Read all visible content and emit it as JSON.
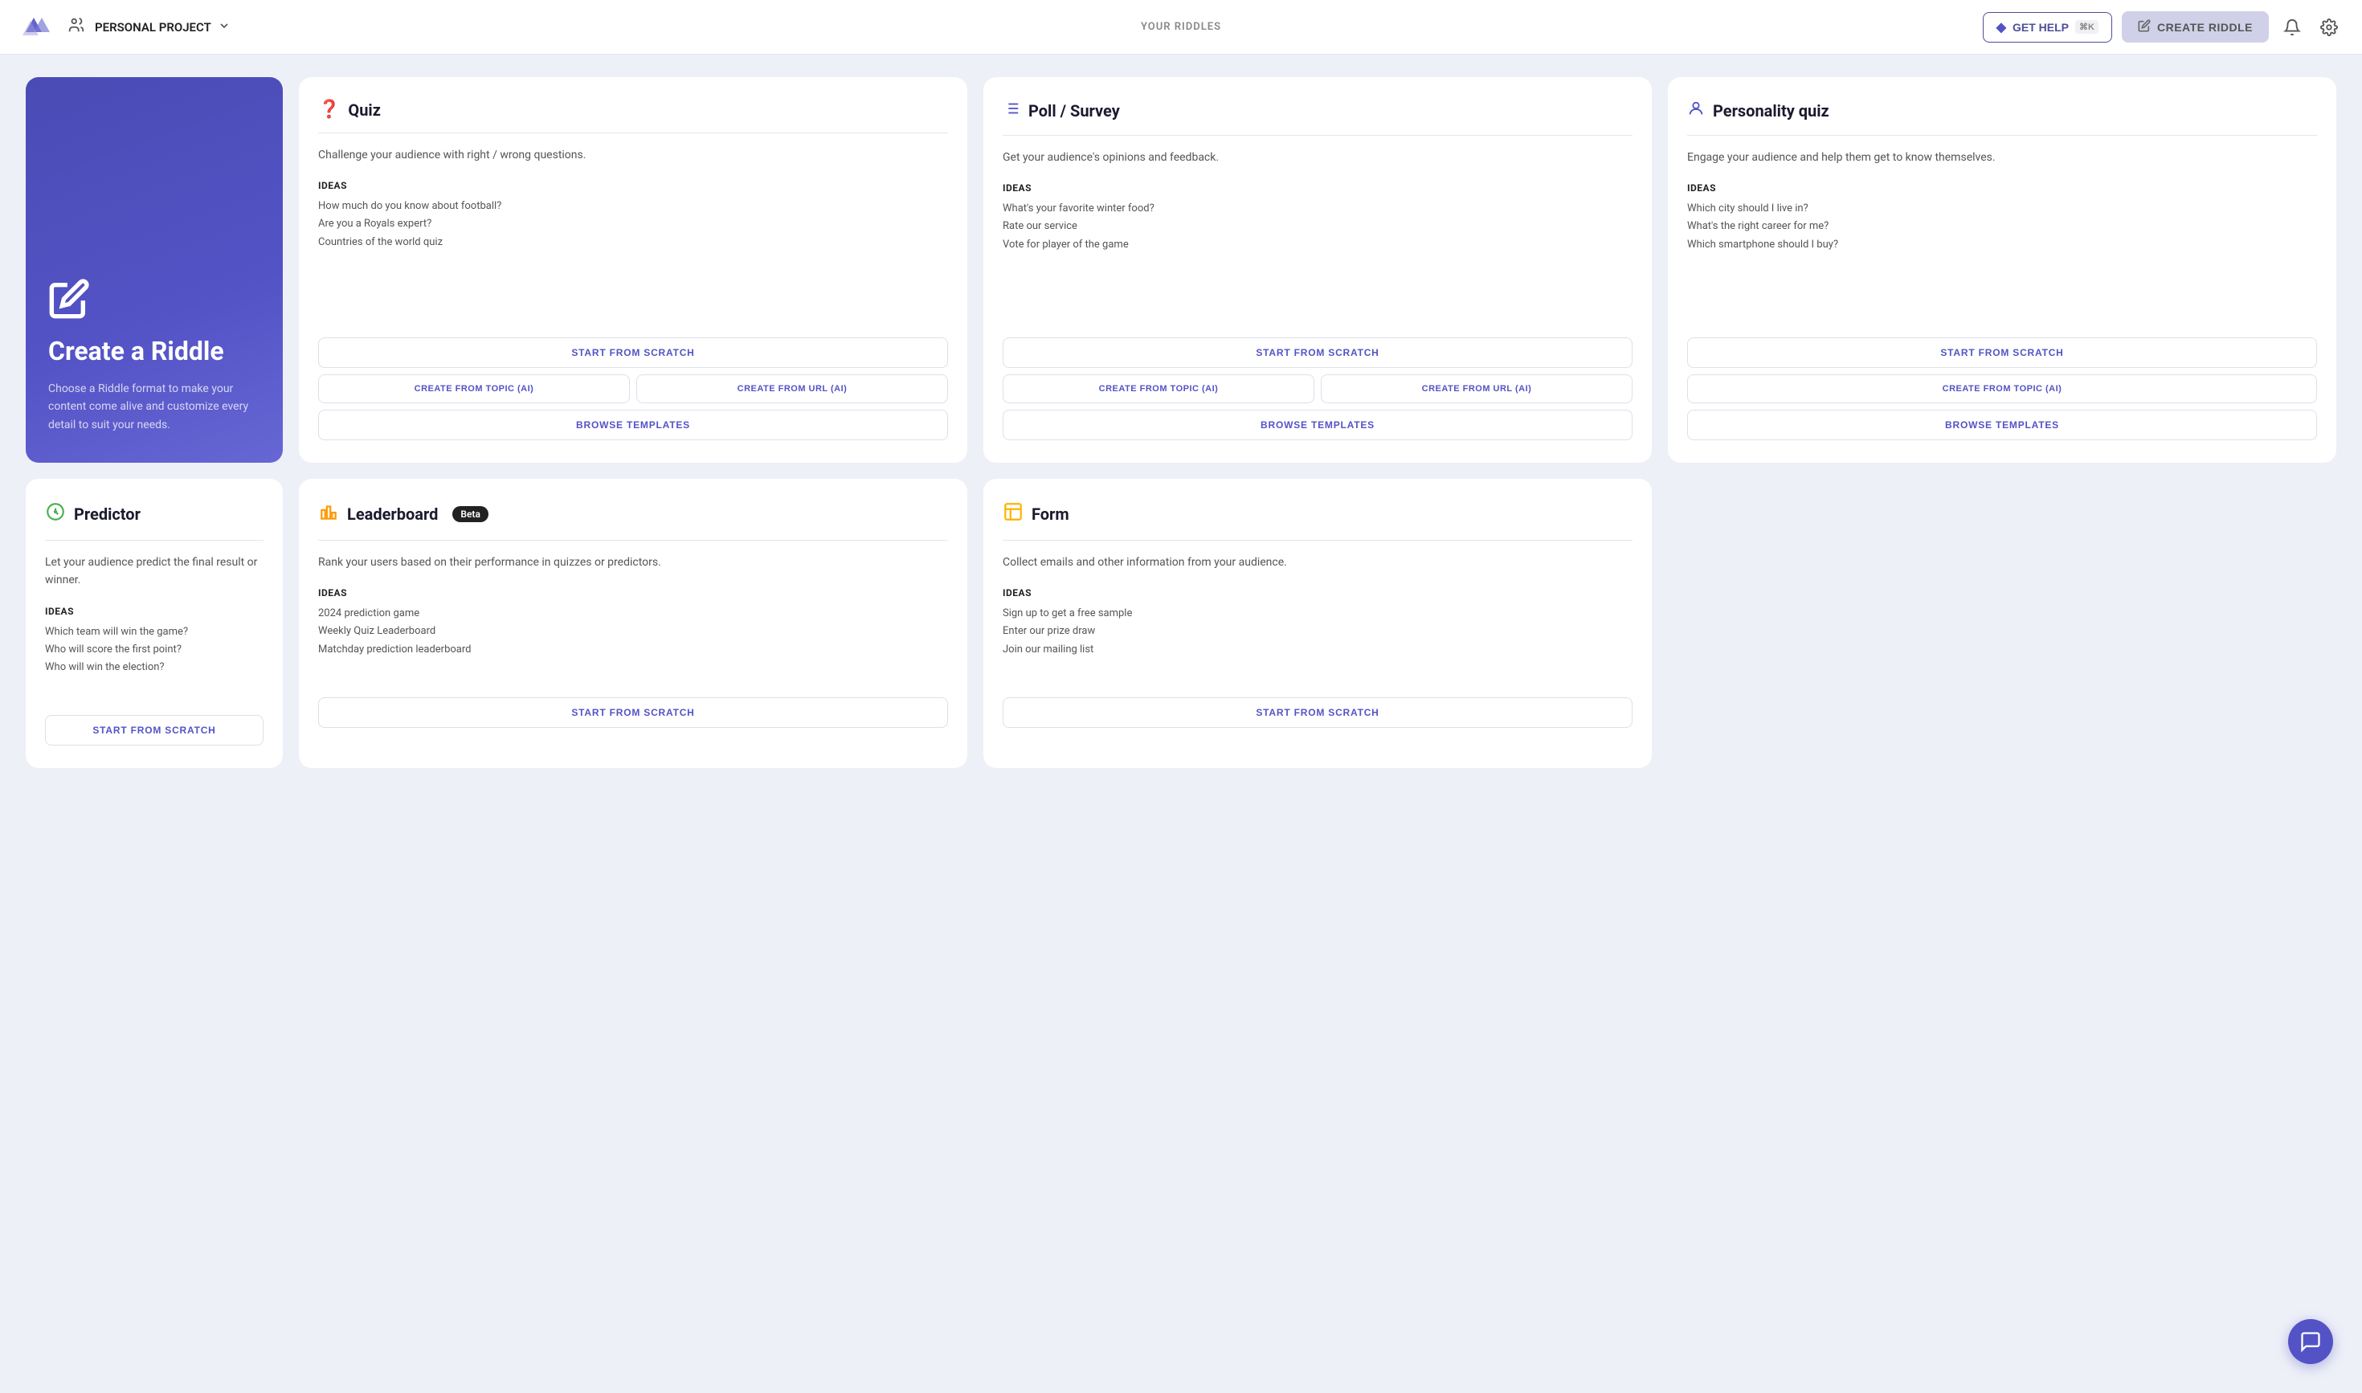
{
  "navbar": {
    "project_label": "PERSONAL PROJECT",
    "center_label": "YOUR RIDDLES",
    "get_help_label": "GET HELP",
    "get_help_shortcut": "⌘K",
    "create_riddle_label": "CREATE RIDDLE"
  },
  "hero": {
    "title": "Create a Riddle",
    "description": "Choose a Riddle format to make your content come alive and customize every detail to suit your needs."
  },
  "cards": [
    {
      "id": "quiz",
      "icon": "❓",
      "title": "Quiz",
      "description": "Challenge your audience with right / wrong questions.",
      "ideas_label": "IDEAS",
      "ideas": [
        "How much do you know about football?",
        "Are you a Royals expert?",
        "Countries of the world quiz"
      ],
      "btn_scratch": "START FROM SCRATCH",
      "btn_topic_ai": "CREATE FROM TOPIC (AI)",
      "btn_url_ai": "CREATE FROM URL (AI)",
      "btn_templates": "BROWSE TEMPLATES",
      "has_url_ai": true
    },
    {
      "id": "poll",
      "icon": "📋",
      "title": "Poll / Survey",
      "description": "Get your audience's opinions and feedback.",
      "ideas_label": "IDEAS",
      "ideas": [
        "What's your favorite winter food?",
        "Rate our service",
        "Vote for player of the game"
      ],
      "btn_scratch": "START FROM SCRATCH",
      "btn_topic_ai": "CREATE FROM TOPIC (AI)",
      "btn_url_ai": "CREATE FROM URL (AI)",
      "btn_templates": "BROWSE TEMPLATES",
      "has_url_ai": true
    },
    {
      "id": "personality",
      "icon": "👤",
      "title": "Personality quiz",
      "description": "Engage your audience and help them get to know themselves.",
      "ideas_label": "IDEAS",
      "ideas": [
        "Which city should I live in?",
        "What's the right career for me?",
        "Which smartphone should I buy?"
      ],
      "btn_scratch": "START FROM SCRATCH",
      "btn_topic_ai": "CREATE FROM TOPIC (AI)",
      "btn_templates": "BROWSE TEMPLATES",
      "has_url_ai": false
    }
  ],
  "bottom_cards": [
    {
      "id": "predictor",
      "icon": "🔮",
      "icon_color": "#4caf50",
      "title": "Predictor",
      "description": "Let your audience predict the final result or winner.",
      "ideas_label": "IDEAS",
      "ideas": [
        "Which team will win the game?",
        "Who will score the first point?",
        "Who will win the election?"
      ],
      "btn_scratch": "START FROM SCRATCH",
      "beta": false
    },
    {
      "id": "leaderboard",
      "icon": "📊",
      "icon_color": "#ff9800",
      "title": "Leaderboard",
      "description": "Rank your users based on their performance in quizzes or predictors.",
      "ideas_label": "IDEAS",
      "ideas": [
        "2024 prediction game",
        "Weekly Quiz Leaderboard",
        "Matchday prediction leaderboard"
      ],
      "btn_scratch": "START FROM SCRATCH",
      "beta": true
    },
    {
      "id": "form",
      "icon": "📝",
      "icon_color": "#ffb300",
      "title": "Form",
      "description": "Collect emails and other information from your audience.",
      "ideas_label": "IDEAS",
      "ideas": [
        "Sign up to get a free sample",
        "Enter our prize draw",
        "Join our mailing list"
      ],
      "btn_scratch": "START FROM SCRATCH",
      "beta": false
    }
  ]
}
